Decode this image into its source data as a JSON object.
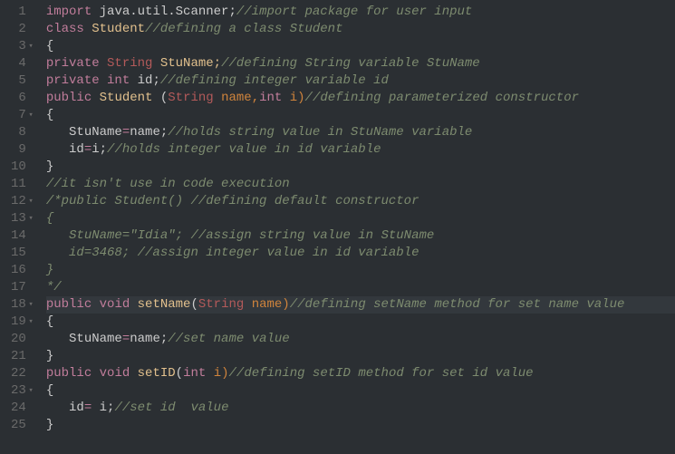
{
  "gutter": {
    "lines": [
      "1",
      "2",
      "3",
      "4",
      "5",
      "6",
      "7",
      "8",
      "9",
      "10",
      "11",
      "12",
      "13",
      "14",
      "15",
      "16",
      "17",
      "18",
      "19",
      "20",
      "21",
      "22",
      "23",
      "24",
      "25"
    ],
    "fold_at": [
      3,
      7,
      12,
      13,
      18,
      19,
      23
    ]
  },
  "code": {
    "l1": {
      "kw": "import",
      "pkg": " java.util.Scanner;",
      "cmt": "//import package for user input"
    },
    "l2": {
      "kw": "class",
      "name": " Student",
      "cmt": "//defining a class Student"
    },
    "l3": {
      "txt": "{"
    },
    "l4": {
      "kw": "private",
      "type": " String",
      "name": " StuName;",
      "cmt": "//defining String variable StuName"
    },
    "l5": {
      "kw": "private",
      "kw2": " int",
      "name": " id;",
      "cmt": "//defining integer variable id"
    },
    "l6": {
      "kw": "public",
      "cls": " Student",
      "pun1": " (",
      "type": "String",
      "p1": " name,",
      "kw2": "int",
      "p2": " i)",
      "cmt": "//defining parameterized constructor"
    },
    "l7": {
      "txt": "{"
    },
    "l8": {
      "lhs": "   StuName",
      "op": "=",
      "rhs": "name;",
      "cmt": "//holds string value in StuName variable"
    },
    "l9": {
      "lhs": "   id",
      "op": "=",
      "rhs": "i;",
      "cmt": "//holds integer value in id variable"
    },
    "l10": {
      "txt": "}"
    },
    "l11": {
      "cmt": "//it isn't use in code execution"
    },
    "l12": {
      "cmt": "/*public Student() //defining default constructor"
    },
    "l13": {
      "cmt": "{"
    },
    "l14": {
      "cmt": "   StuName=\"Idia\"; //assign string value in StuName"
    },
    "l15": {
      "cmt": "   id=3468; //assign integer value in id variable"
    },
    "l16": {
      "cmt": "}"
    },
    "l17": {
      "cmt": "*/"
    },
    "l18": {
      "kw": "public",
      "kw2": " void",
      "cls": " setName",
      "pun1": "(",
      "type": "String",
      "p1": " name)",
      "cmt": "//defining setName method for set name value"
    },
    "l19": {
      "txt": "{"
    },
    "l20": {
      "lhs": "   StuName",
      "op": "=",
      "rhs": "name;",
      "cmt": "//set name value"
    },
    "l21": {
      "txt": "}"
    },
    "l22": {
      "kw": "public",
      "kw2": " void",
      "cls": " setID",
      "pun1": "(",
      "kw3": "int",
      "p1": " i)",
      "cmt": "//defining setID method for set id value"
    },
    "l23": {
      "txt": "{"
    },
    "l24": {
      "lhs": "   id",
      "op": "=",
      "rhs": " i;",
      "cmt": "//set id  value"
    },
    "l25": {
      "txt": "}"
    }
  }
}
